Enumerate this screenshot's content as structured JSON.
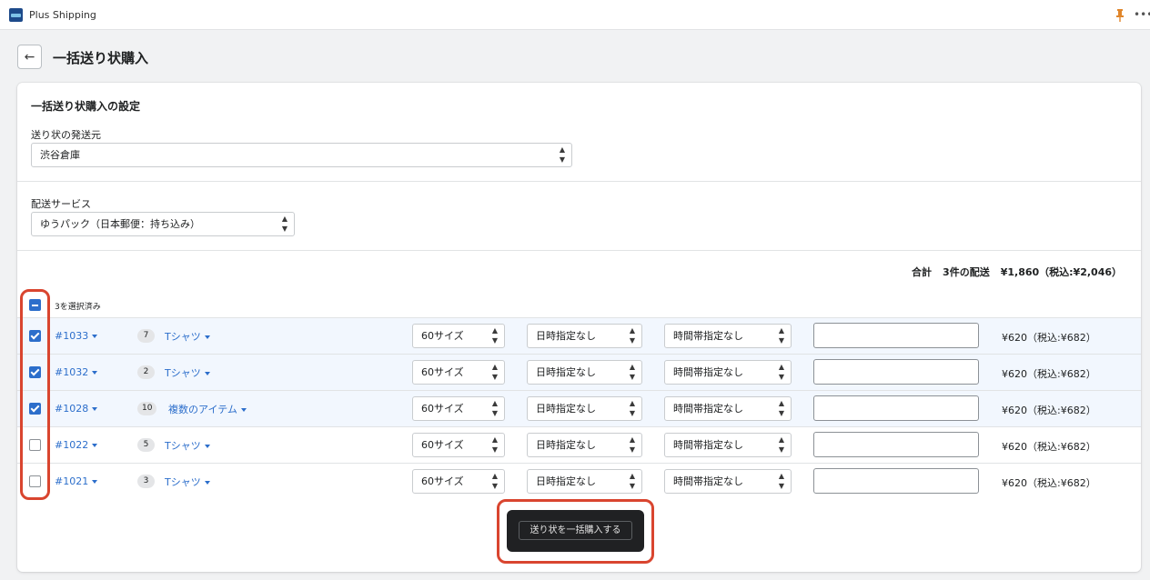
{
  "app": {
    "name": "Plus Shipping"
  },
  "page": {
    "title": "一括送り状購入"
  },
  "settings": {
    "section_title": "一括送り状購入の設定",
    "origin_label": "送り状の発送元",
    "origin_value": "渋谷倉庫",
    "service_label": "配送サービス",
    "service_value": "ゆうパック（日本郵便：持ち込み）"
  },
  "summary": {
    "label": "合計",
    "count": "3件の配送",
    "amount": "¥1,860（税込:¥2,046）"
  },
  "selection": {
    "label": "3を選択済み",
    "state": "partial"
  },
  "rows": [
    {
      "order": "#1033",
      "qty": "7",
      "item": "Tシャツ",
      "size": "60サイズ",
      "date": "日時指定なし",
      "time": "時間帯指定なし",
      "note": "",
      "price": "¥620（税込:¥682）",
      "checked": true
    },
    {
      "order": "#1032",
      "qty": "2",
      "item": "Tシャツ",
      "size": "60サイズ",
      "date": "日時指定なし",
      "time": "時間帯指定なし",
      "note": "",
      "price": "¥620（税込:¥682）",
      "checked": true
    },
    {
      "order": "#1028",
      "qty": "10",
      "item": "複数のアイテム",
      "size": "60サイズ",
      "date": "日時指定なし",
      "time": "時間帯指定なし",
      "note": "",
      "price": "¥620（税込:¥682）",
      "checked": true
    },
    {
      "order": "#1022",
      "qty": "5",
      "item": "Tシャツ",
      "size": "60サイズ",
      "date": "日時指定なし",
      "time": "時間帯指定なし",
      "note": "",
      "price": "¥620（税込:¥682）",
      "checked": false
    },
    {
      "order": "#1021",
      "qty": "3",
      "item": "Tシャツ",
      "size": "60サイズ",
      "date": "日時指定なし",
      "time": "時間帯指定なし",
      "note": "",
      "price": "¥620（税込:¥682）",
      "checked": false
    }
  ],
  "actions": {
    "buy_label": "送り状を一括購入する"
  },
  "colors": {
    "accent": "#2c6ecb",
    "highlight": "#d9452f",
    "selected_row": "#f2f7fe",
    "dark_button": "#202123"
  }
}
